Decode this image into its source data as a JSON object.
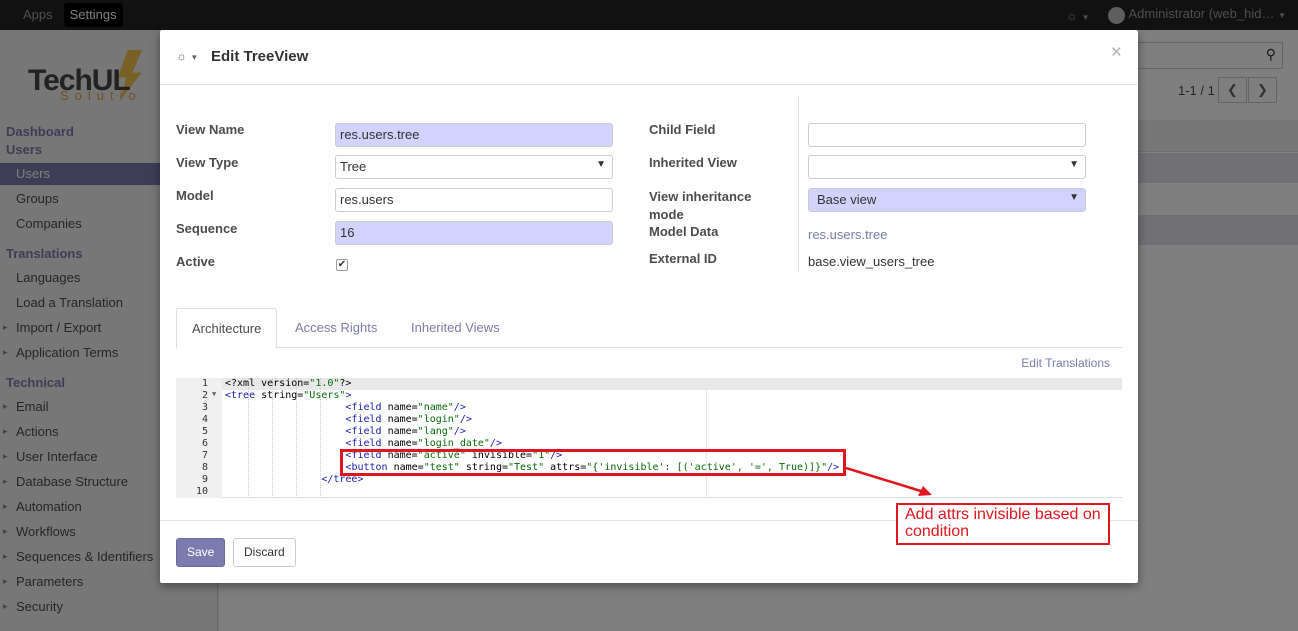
{
  "topbar": {
    "apps": "Apps",
    "settings": "Settings",
    "debug_icon": "bug-icon",
    "user": "Administrator (web_hid…"
  },
  "logo": {
    "main": "TechUL",
    "sub": "Solutio"
  },
  "sidebar": {
    "dashboard": "Dashboard",
    "users_section": "Users",
    "users": "Users",
    "groups": "Groups",
    "companies": "Companies",
    "translations_section": "Translations",
    "languages": "Languages",
    "load_translation": "Load a Translation",
    "import_export": "Import / Export",
    "app_terms": "Application Terms",
    "technical_section": "Technical",
    "email": "Email",
    "actions": "Actions",
    "user_interface": "User Interface",
    "db_structure": "Database Structure",
    "automation": "Automation",
    "workflows": "Workflows",
    "sequences": "Sequences & Identifiers",
    "parameters": "Parameters",
    "security": "Security"
  },
  "list": {
    "pager": "1-1 / 1",
    "prev": "❮",
    "next": "❯"
  },
  "modal": {
    "title": "Edit TreeView",
    "close": "×",
    "fields": {
      "view_name_label": "View Name",
      "view_name": "res.users.tree",
      "view_type_label": "View Type",
      "view_type": "Tree",
      "model_label": "Model",
      "model": "res.users",
      "sequence_label": "Sequence",
      "sequence": "16",
      "active_label": "Active",
      "child_field_label": "Child Field",
      "child_field": "",
      "inherited_view_label": "Inherited View",
      "inherited_view": "",
      "inheritance_mode_label_1": "View inheritance",
      "inheritance_mode_label_2": "mode",
      "inheritance_mode": "Base view",
      "model_data_label": "Model Data",
      "model_data": "res.users.tree",
      "external_id_label": "External ID",
      "external_id": "base.view_users_tree"
    },
    "tabs": [
      "Architecture",
      "Access Rights",
      "Inherited Views"
    ],
    "edit_translations": "Edit Translations",
    "save": "Save",
    "discard": "Discard"
  },
  "annotation": {
    "line1": "Add attrs invisible based on",
    "line2": "condition",
    "color": "#e0151d"
  },
  "colors": {
    "accent": "#7c7bad",
    "required_bg": "#d2d2ff",
    "topbar": "#222222"
  }
}
